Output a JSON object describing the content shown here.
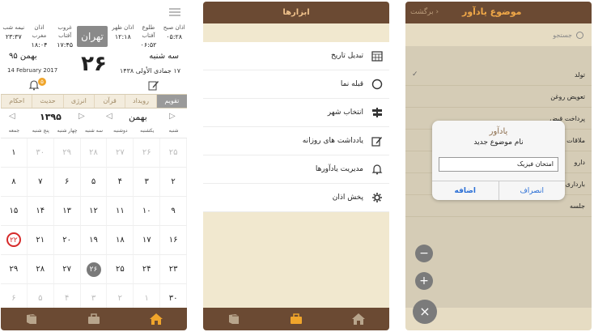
{
  "screen1": {
    "prayer_times": [
      {
        "label": "اذان صبح",
        "time": "۰۵:۲۸"
      },
      {
        "label": "طلوع آفتاب",
        "time": "۰۶:۵۲"
      },
      {
        "label": "اذان ظهر",
        "time": "۱۲:۱۸"
      },
      {
        "label": "غروب آفتاب",
        "time": "۱۷:۴۵"
      },
      {
        "label": "اذان مغرب",
        "time": "۱۸:۰۴"
      },
      {
        "label": "نیمه شب",
        "time": "۲۳:۳۷"
      }
    ],
    "city": "تهران",
    "day_number": "۲۶",
    "weekday": "سه شنبه",
    "persian_month": "بهمن ۹۵",
    "hijri_date": "۱۷ جمادی الأولی ۱۴۳۸",
    "gregorian_date": "14 February 2017",
    "notification_count": "۵",
    "tabs": [
      "تقویم",
      "رویداد",
      "قرآن",
      "انرژی",
      "حدیث",
      "احکام"
    ],
    "year": "۱۳۹۵",
    "month": "بهمن",
    "weekdays": [
      "شنبه",
      "یکشنبه",
      "دوشنبه",
      "سه شنبه",
      "چهار شنبه",
      "پنج شنبه",
      "جمعه"
    ],
    "days": [
      [
        "۲۵",
        "۲۶",
        "۲۷",
        "۲۸",
        "۲۹",
        "۳۰",
        "۱"
      ],
      [
        "۲",
        "۳",
        "۴",
        "۵",
        "۶",
        "۷",
        "۸"
      ],
      [
        "۹",
        "۱۰",
        "۱۱",
        "۱۲",
        "۱۳",
        "۱۴",
        "۱۵"
      ],
      [
        "۱۶",
        "۱۷",
        "۱۸",
        "۱۹",
        "۲۰",
        "۲۱",
        "۲۲"
      ],
      [
        "۲۳",
        "۲۴",
        "۲۵",
        "۲۶",
        "۲۷",
        "۲۸",
        "۲۹"
      ],
      [
        "۳۰",
        "۱",
        "۲",
        "۳",
        "۴",
        "۵",
        "۶"
      ]
    ]
  },
  "screen2": {
    "title": "ابزارها",
    "items": [
      {
        "label": "تبدیل تاریخ",
        "icon": "calendar-icon"
      },
      {
        "label": "قبله نما",
        "icon": "compass-icon"
      },
      {
        "label": "انتخاب شهر",
        "icon": "signpost-icon"
      },
      {
        "label": "یادداشت های روزانه",
        "icon": "note-edit-icon"
      },
      {
        "label": "مدیریت یادآورها",
        "icon": "bell-icon"
      },
      {
        "label": "پخش اذان",
        "icon": "gear-icon"
      }
    ]
  },
  "screen3": {
    "back": "برگشت",
    "title": "موضوع یادآور",
    "search_placeholder": "جستجو",
    "topics": [
      "تولد",
      "تعویض روغن",
      "پرداخت قبض",
      "ملاقات",
      "دارو",
      "بارداری",
      "جلسه"
    ],
    "dialog": {
      "title": "یادآور",
      "message": "نام موضوع جدید",
      "input_value": "امتحان فیزیک",
      "cancel": "انصراف",
      "add": "اضافه"
    },
    "fabs": [
      "−",
      "+",
      "×"
    ]
  },
  "colors": {
    "bar_brown": "#6b4a33",
    "accent_orange": "#f0a848",
    "home_icon": "#f0a52b",
    "paper": "#f1e8cf",
    "holiday_red": "#d62a2a",
    "link_blue": "#2b6fd6"
  }
}
